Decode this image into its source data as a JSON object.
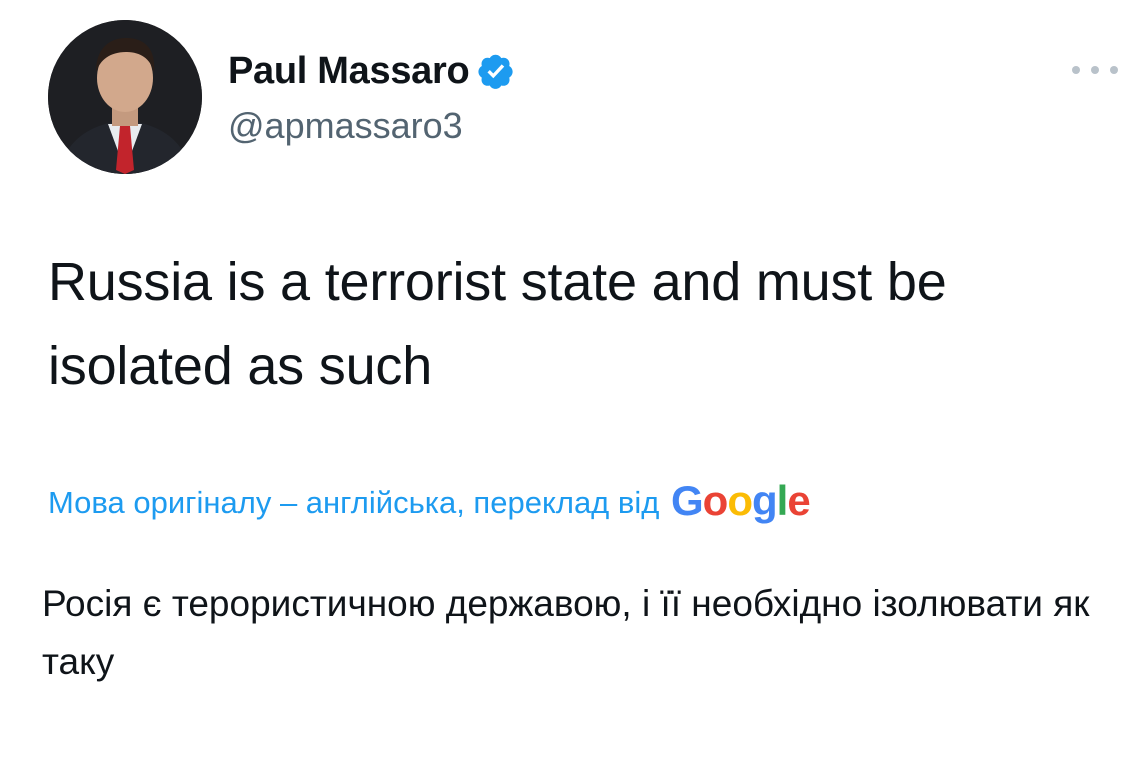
{
  "author": {
    "display_name": "Paul Massaro",
    "handle": "@apmassaro3",
    "verified": true,
    "avatar_icon": "profile-photo"
  },
  "tweet": {
    "text": "Russia is a terrorist state and must be isolated as such"
  },
  "translation": {
    "link_text": "Мова оригіналу – англійська, переклад від",
    "provider": "Google",
    "translated_text": "Росія є терористичною державою, і її необхідно ізолювати як таку"
  },
  "icons": {
    "more": "more-horizontal-icon",
    "verified": "verified-badge-icon"
  },
  "colors": {
    "link": "#1d9bf0",
    "handle": "#536471",
    "text": "#0f1419",
    "verified": "#1d9bf0"
  }
}
